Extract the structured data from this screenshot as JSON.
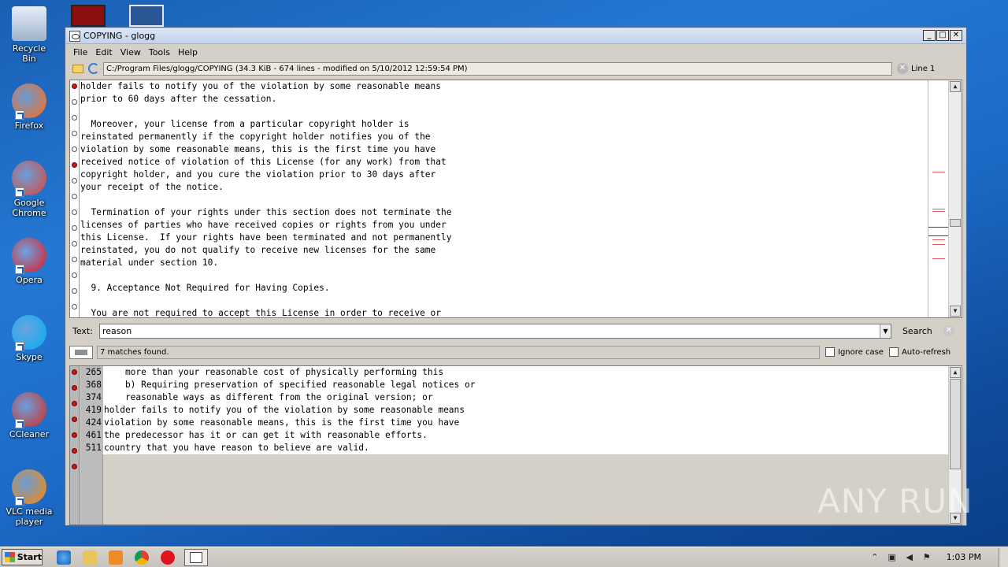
{
  "desktop": {
    "icons": [
      {
        "label": "Recycle Bin",
        "icon": "recycle-bin-icon",
        "color": "#c9d6e8"
      },
      {
        "label": "Firefox",
        "icon": "firefox-icon",
        "color": "#ff6a13"
      },
      {
        "label": "Google Chrome",
        "icon": "chrome-icon",
        "color": "#db4437"
      },
      {
        "label": "Opera",
        "icon": "opera-icon",
        "color": "#e0141e"
      },
      {
        "label": "Skype",
        "icon": "skype-icon",
        "color": "#00aff0"
      },
      {
        "label": "CCleaner",
        "icon": "ccleaner-icon",
        "color": "#d52a1e"
      },
      {
        "label": "VLC media player",
        "icon": "vlc-icon",
        "color": "#ff8800"
      }
    ]
  },
  "window": {
    "title": "COPYING - glogg",
    "controls": {
      "minimize": "_",
      "maximize": "□",
      "close": "✕"
    }
  },
  "menu": [
    "File",
    "Edit",
    "View",
    "Tools",
    "Help"
  ],
  "pathbar": {
    "path": "C:/Program Files/glogg/COPYING (34.3 KiB - 674 lines - modified on 5/10/2012 12:59:54 PM)",
    "line": "Line 1"
  },
  "top_view": {
    "lines": [
      {
        "text": "holder fails to notify you of the violation by some reasonable means",
        "hit": true
      },
      {
        "text": "prior to 60 days after the cessation.",
        "hit": false
      },
      {
        "text": "",
        "hit": false
      },
      {
        "text": "  Moreover, your license from a particular copyright holder is",
        "hit": false
      },
      {
        "text": "reinstated permanently if the copyright holder notifies you of the",
        "hit": false
      },
      {
        "text": "violation by some reasonable means, this is the first time you have",
        "hit": true
      },
      {
        "text": "received notice of violation of this License (for any work) from that",
        "hit": false
      },
      {
        "text": "copyright holder, and you cure the violation prior to 30 days after",
        "hit": false
      },
      {
        "text": "your receipt of the notice.",
        "hit": false
      },
      {
        "text": "",
        "hit": false
      },
      {
        "text": "  Termination of your rights under this section does not terminate the",
        "hit": false
      },
      {
        "text": "licenses of parties who have received copies or rights from you under",
        "hit": false
      },
      {
        "text": "this License.  If your rights have been terminated and not permanently",
        "hit": false
      },
      {
        "text": "reinstated, you do not qualify to receive new licenses for the same",
        "hit": false
      },
      {
        "text": "material under section 10.",
        "hit": false
      },
      {
        "text": "",
        "hit": false
      },
      {
        "text": "  9. Acceptance Not Required for Having Copies.",
        "hit": false
      },
      {
        "text": "",
        "hit": false
      },
      {
        "text": "  You are not required to accept this License in order to receive or",
        "hit": false
      }
    ]
  },
  "search": {
    "label": "Text:",
    "value": "reason",
    "button": "Search",
    "status": "7 matches found.",
    "ignore_case": "Ignore case",
    "auto_refresh": "Auto-refresh"
  },
  "matches": [
    {
      "line": "265",
      "text": "    more than your reasonable cost of physically performing this"
    },
    {
      "line": "368",
      "text": "    b) Requiring preservation of specified reasonable legal notices or"
    },
    {
      "line": "374",
      "text": "    reasonable ways as different from the original version; or"
    },
    {
      "line": "419",
      "text": "holder fails to notify you of the violation by some reasonable means"
    },
    {
      "line": "424",
      "text": "violation by some reasonable means, this is the first time you have"
    },
    {
      "line": "461",
      "text": "the predecessor has it or can get it with reasonable efforts."
    },
    {
      "line": "511",
      "text": "country that you have reason to believe are valid."
    }
  ],
  "watermark": "ANY RUN",
  "taskbar": {
    "start": "Start",
    "clock": "1:03 PM"
  }
}
